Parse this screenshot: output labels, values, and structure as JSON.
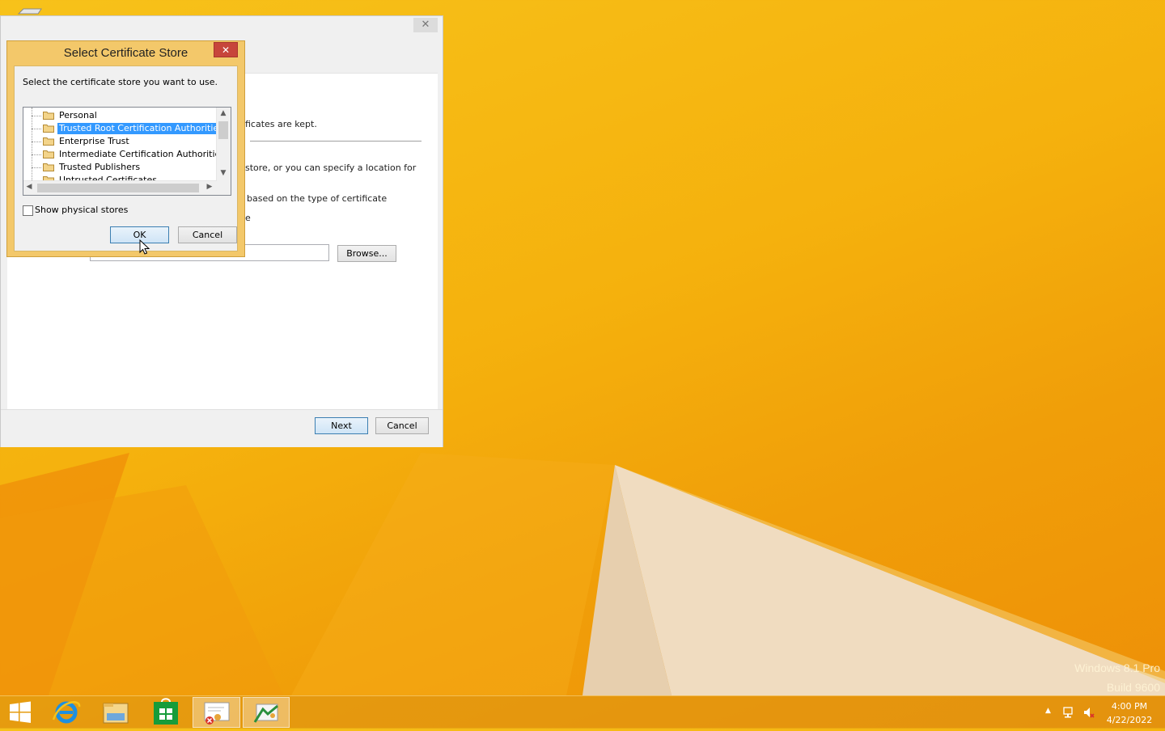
{
  "desktop": {
    "watermark_line1": "Windows 8.1 Pro",
    "watermark_line2": "Build 9600"
  },
  "wizard": {
    "close_glyph": "✕",
    "text_kept": "ficates are kept.",
    "text_specify": "store, or you can specify a location for",
    "text_type": "based on the type of certificate",
    "text_e": "e",
    "browse_label": "Browse...",
    "next_label": "Next",
    "cancel_label": "Cancel"
  },
  "dialog": {
    "title": "Select Certificate Store",
    "close_glyph": "✕",
    "instruction": "Select the certificate store you want to use.",
    "stores": [
      {
        "label": "Personal",
        "selected": false
      },
      {
        "label": "Trusted Root Certification Authorities",
        "selected": true
      },
      {
        "label": "Enterprise Trust",
        "selected": false
      },
      {
        "label": "Intermediate Certification Authorities",
        "selected": false
      },
      {
        "label": "Trusted Publishers",
        "selected": false
      },
      {
        "label": "Untrusted Certificates",
        "selected": false
      }
    ],
    "show_physical_label": "Show physical stores",
    "show_physical_checked": false,
    "ok_label": "OK",
    "cancel_label": "Cancel"
  },
  "taskbar": {
    "buttons": [
      "start-icon",
      "internet-explorer-icon",
      "file-explorer-icon",
      "store-icon",
      "certificate-manager-icon",
      "certificate-import-wizard-icon"
    ],
    "clock_time": "4:00 PM",
    "clock_date": "4/22/2022"
  },
  "colors": {
    "accent_selection": "#3399ff",
    "dialog_frame": "#f3c86a",
    "close_red": "#c7453b",
    "desktop": "#f5b10d"
  }
}
